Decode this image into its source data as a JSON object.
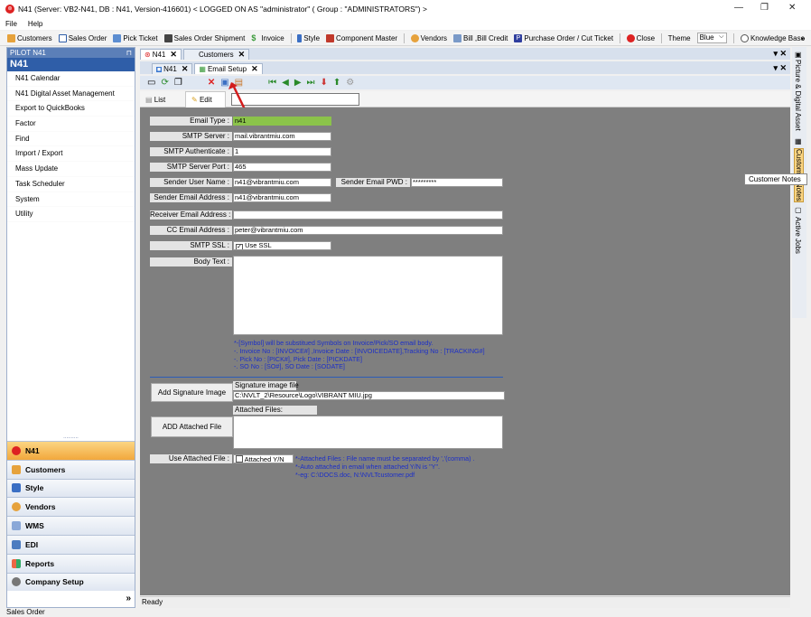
{
  "window": {
    "title": "N41  (Server: VB2-N41, DB : N41, Version-416601)    < LOGGED ON AS \"administrator\" ( Group : \"ADMINISTRATORS\") >",
    "minimize": "—",
    "maximize": "❐",
    "close": "✕"
  },
  "menu": [
    "File",
    "Help"
  ],
  "toolbar": {
    "items": [
      "Customers",
      "Sales Order",
      "Pick Ticket",
      "Sales Order Shipment",
      "Invoice",
      "Style",
      "Component Master",
      "Vendors",
      "Bill ,Bill Credit",
      "Purchase Order / Cut Ticket",
      "Close"
    ],
    "theme_label": "Theme",
    "theme_value": "Blue",
    "knowledge_base": "Knowledge Base",
    "overflow": "»"
  },
  "left_panel": {
    "header": "PILOT N41",
    "pin": "⊓",
    "title": "N41",
    "items": [
      "N41 Calendar",
      "N41 Digital Asset Management",
      "Export to QuickBooks",
      "Factor",
      "Find",
      "Import / Export",
      "Mass Update",
      "Task Scheduler",
      "System",
      "Utility"
    ],
    "grip": "..........",
    "nav": [
      "N41",
      "Customers",
      "Style",
      "Vendors",
      "WMS",
      "EDI",
      "Reports",
      "Company Setup"
    ],
    "expand": "»"
  },
  "tabs_outer": [
    {
      "label": "N41"
    },
    {
      "label": "Customers"
    }
  ],
  "tabs_inner": [
    {
      "label": "N41"
    },
    {
      "label": "Email Setup"
    }
  ],
  "tab_close": "✕",
  "pane_menu": "▾ ✕",
  "mode_tabs": {
    "list": "List",
    "edit": "Edit"
  },
  "form": {
    "email_type": {
      "label": "Email Type :",
      "value": "n41"
    },
    "smtp_server": {
      "label": "SMTP Server :",
      "value": "mail.vibrantmiu.com"
    },
    "smtp_auth": {
      "label": "SMTP Authenticate :",
      "value": "1"
    },
    "smtp_port": {
      "label": "SMTP Server Port :",
      "value": "465"
    },
    "sender_user": {
      "label": "Sender User Name :",
      "value": "n41@vibrantmiu.com"
    },
    "sender_pwd": {
      "label": "Sender Email PWD :",
      "value": "*********"
    },
    "sender_email": {
      "label": "Sender Email Address :",
      "value": "n41@vibrantmiu.com"
    },
    "receiver_email": {
      "label": "Receiver Email Address :",
      "value": ""
    },
    "cc_email": {
      "label": "CC Email Address :",
      "value": "peter@vibrantmiu.com"
    },
    "smtp_ssl": {
      "label": "SMTP SSL :",
      "value": "Use SSL"
    },
    "body_text": {
      "label": "Body Text :",
      "value": ""
    },
    "notes": [
      "*-[Symbol] will be substitued Symbols on Invoice/Pick/SO email body.",
      "-. Invoice No : [INVOICE#] ,Invoice Date : [INVOICEDATE],Tracking No : [TRACKING#]",
      "-. Pick No : [PICK#], Pick Date : [PICKDATE]",
      "-. SO No : [SO#], SO Date : [SODATE]"
    ],
    "add_signature_button": "Add Signature Image",
    "signature_label": "Signature image file",
    "signature_path": "C:\\NVLT_2\\Resource\\Logo\\VIBRANT MIU.jpg",
    "add_attached_button": "ADD Attached File",
    "attached_label": "Attached Files:",
    "use_attached": {
      "label": "Use Attached File :",
      "value": "Attached Y/N"
    },
    "attach_notes": [
      "*-Attached Files : File name must be separated by ','(comma) .",
      "*-Auto attached in email when attached Y/N is \"Y\".",
      "*-eg: C:\\DOCS.doc, N:\\NVLTcustomer.pdf"
    ]
  },
  "status": "Ready",
  "bottom_status": "Sales Order",
  "right_rail": [
    "Picture & Digital Asset",
    "Customer Notes",
    "Active Jobs"
  ],
  "tooltip": "Customer Notes",
  "colors": {
    "accent": "#2f5ea8",
    "active_nav": "#f2a83c",
    "email_type_bg": "#8bc34a",
    "note_text": "#1c2fc8",
    "arrow": "#d21c1c"
  }
}
